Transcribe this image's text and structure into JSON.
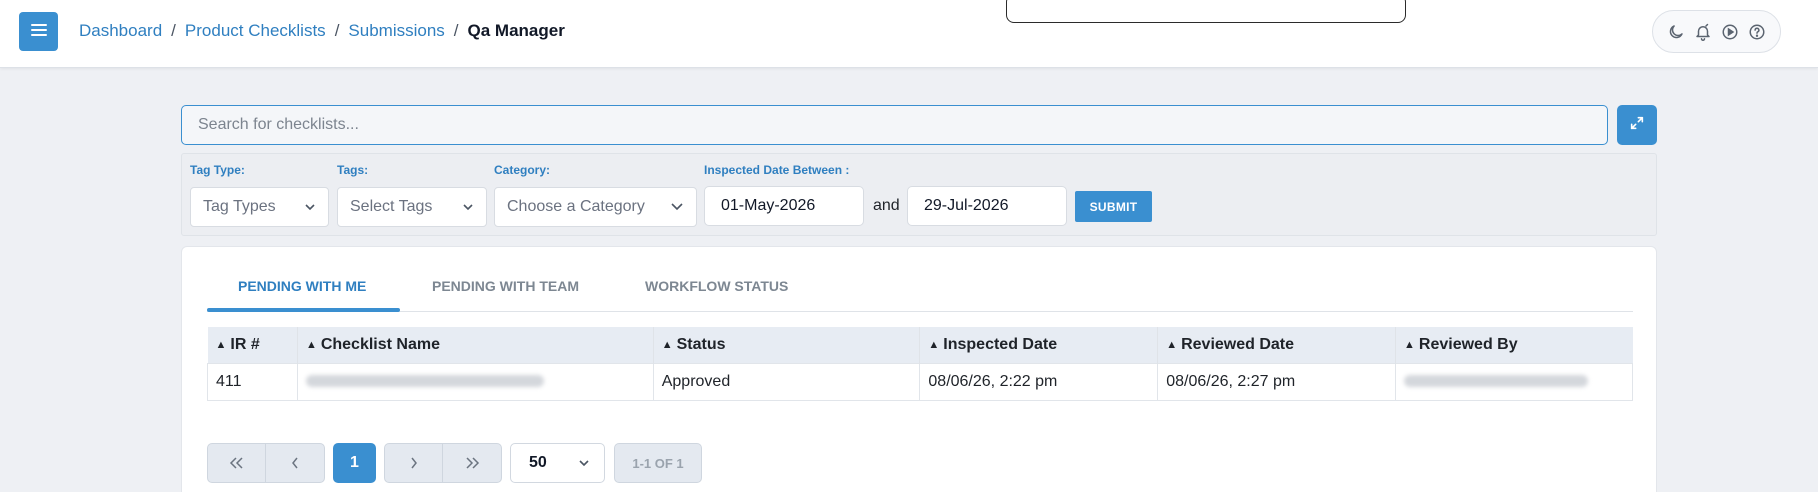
{
  "header": {
    "menu_icon": "hamburger-menu-icon",
    "breadcrumb": {
      "items": [
        "Dashboard",
        "Product Checklists",
        "Submissions"
      ],
      "separator": "/",
      "current": "Qa Manager"
    },
    "actions": [
      {
        "name": "theme",
        "icon": "moon-icon"
      },
      {
        "name": "notifications",
        "icon": "bell-icon"
      },
      {
        "name": "play",
        "icon": "play-circle-icon"
      },
      {
        "name": "help",
        "icon": "help-circle-icon"
      }
    ]
  },
  "search": {
    "placeholder": "Search for checklists...",
    "value": "",
    "expand_icon": "expand-icon"
  },
  "filters": {
    "tag_type": {
      "label": "Tag Type:",
      "value": "Tag Types"
    },
    "tags": {
      "label": "Tags:",
      "value": "Select Tags"
    },
    "category": {
      "label": "Category:",
      "value": "Choose a Category"
    },
    "date_range": {
      "label": "Inspected Date Between :",
      "from": "01-May-2026",
      "joiner": "and",
      "to": "29-Jul-2026"
    },
    "submit_label": "SUBMIT"
  },
  "tabs": [
    {
      "label": "PENDING WITH ME",
      "active": true
    },
    {
      "label": "PENDING WITH TEAM",
      "active": false
    },
    {
      "label": "WORKFLOW STATUS",
      "active": false
    }
  ],
  "table": {
    "columns": [
      "IR #",
      "Checklist Name",
      "Status",
      "Inspected Date",
      "Reviewed Date",
      "Reviewed By"
    ],
    "rows": [
      {
        "ir": "411",
        "checklist_name": "",
        "status": "Approved",
        "inspected_date": "08/06/26, 2:22 pm",
        "reviewed_date": "08/06/26, 2:27 pm",
        "reviewed_by": ""
      }
    ]
  },
  "pagination": {
    "current_page": "1",
    "page_size": "50",
    "info": "1-1 OF 1"
  },
  "colors": {
    "accent": "#3a8fd0",
    "link": "#2f7fc0",
    "page_bg": "#eef0f4",
    "header_row_bg": "#e7ecf3"
  }
}
